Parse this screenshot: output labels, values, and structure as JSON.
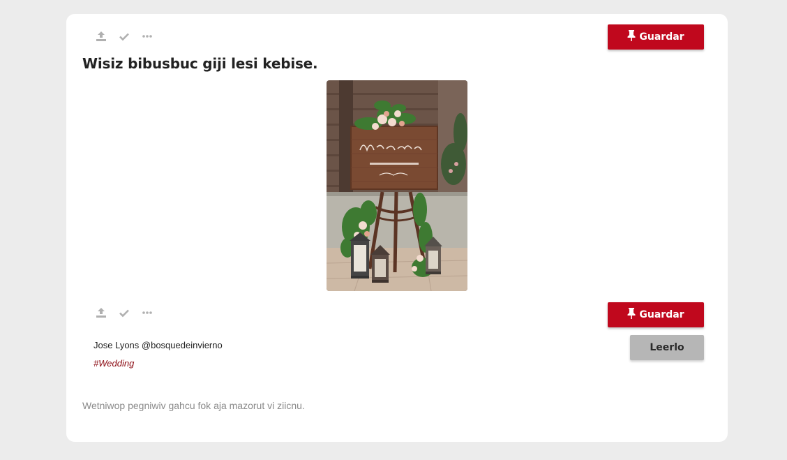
{
  "colors": {
    "page_background": "#ececec",
    "card_background": "#ffffff",
    "save_button": "#c0081d",
    "read_button": "#b6b6b6",
    "icon": "#b0b0b0",
    "hashtag": "#8b0a12"
  },
  "post": {
    "title": "Wisiz bibusbuc giji lesi kebise.",
    "image_alt_icon": "wedding-welcome-sign-image",
    "author": "Jose Lyons @bosquedeinvierno",
    "hashtag": "#Wedding",
    "description": "Wetniwop pegniwiv gahcu fok aja mazorut vi ziicnu."
  },
  "actions": {
    "icons": [
      "share-upload-icon",
      "check-icon",
      "more-dots-icon"
    ],
    "save_label": "Guardar",
    "save_icon": "pin-icon",
    "read_label": "Leerlo"
  }
}
